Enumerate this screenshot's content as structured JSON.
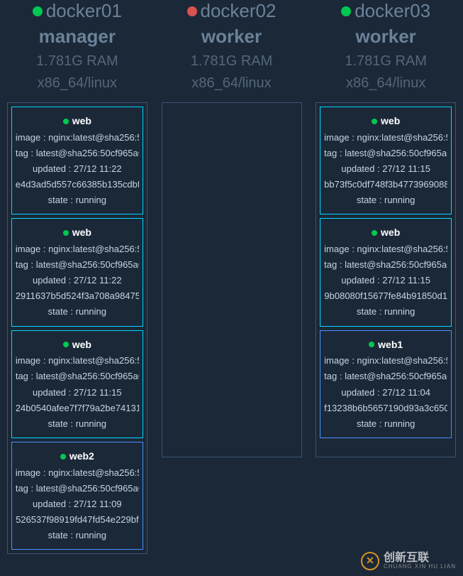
{
  "nodes": [
    {
      "name": "docker01",
      "status": "green",
      "role": "manager",
      "ram": "1.781G RAM",
      "arch": "x86_64/linux",
      "services": [
        {
          "name": "web",
          "border": "cyan",
          "image": "image : nginx:latest@sha256:5",
          "tag": "tag : latest@sha256:50cf965a6",
          "updated": "updated : 27/12 11:22",
          "id": "e4d3ad5d557c66385b135cdbf",
          "state": "state : running"
        },
        {
          "name": "web",
          "border": "cyan",
          "image": "image : nginx:latest@sha256:5",
          "tag": "tag : latest@sha256:50cf965a6",
          "updated": "updated : 27/12 11:22",
          "id": "2911637b5d524f3a708a98475",
          "state": "state : running"
        },
        {
          "name": "web",
          "border": "cyan",
          "image": "image : nginx:latest@sha256:5",
          "tag": "tag : latest@sha256:50cf965a6",
          "updated": "updated : 27/12 11:15",
          "id": "24b0540afee7f7f79a2be74131",
          "state": "state : running"
        },
        {
          "name": "web2",
          "border": "blue",
          "image": "image : nginx:latest@sha256:5",
          "tag": "tag : latest@sha256:50cf965a6",
          "updated": "updated : 27/12 11:09",
          "id": "526537f98919fd47fd54e229bf",
          "state": "state : running"
        }
      ]
    },
    {
      "name": "docker02",
      "status": "red",
      "role": "worker",
      "ram": "1.781G RAM",
      "arch": "x86_64/linux",
      "services": []
    },
    {
      "name": "docker03",
      "status": "green",
      "role": "worker",
      "ram": "1.781G RAM",
      "arch": "x86_64/linux",
      "services": [
        {
          "name": "web",
          "border": "cyan",
          "image": "image : nginx:latest@sha256:5",
          "tag": "tag : latest@sha256:50cf965a6",
          "updated": "updated : 27/12 11:15",
          "id": "bb73f5c0df748f3b4773969088",
          "state": "state : running"
        },
        {
          "name": "web",
          "border": "cyan",
          "image": "image : nginx:latest@sha256:5",
          "tag": "tag : latest@sha256:50cf965a6",
          "updated": "updated : 27/12 11:15",
          "id": "9b08080f15677fe84b91850d1",
          "state": "state : running"
        },
        {
          "name": "web1",
          "border": "blue",
          "image": "image : nginx:latest@sha256:5",
          "tag": "tag : latest@sha256:50cf965a6",
          "updated": "updated : 27/12 11:04",
          "id": "f13238b6b5657190d93a3c650",
          "state": "state : running"
        }
      ]
    }
  ],
  "watermark": {
    "cn": "创新互联",
    "en": "CHUANG XIN HU LIAN"
  }
}
